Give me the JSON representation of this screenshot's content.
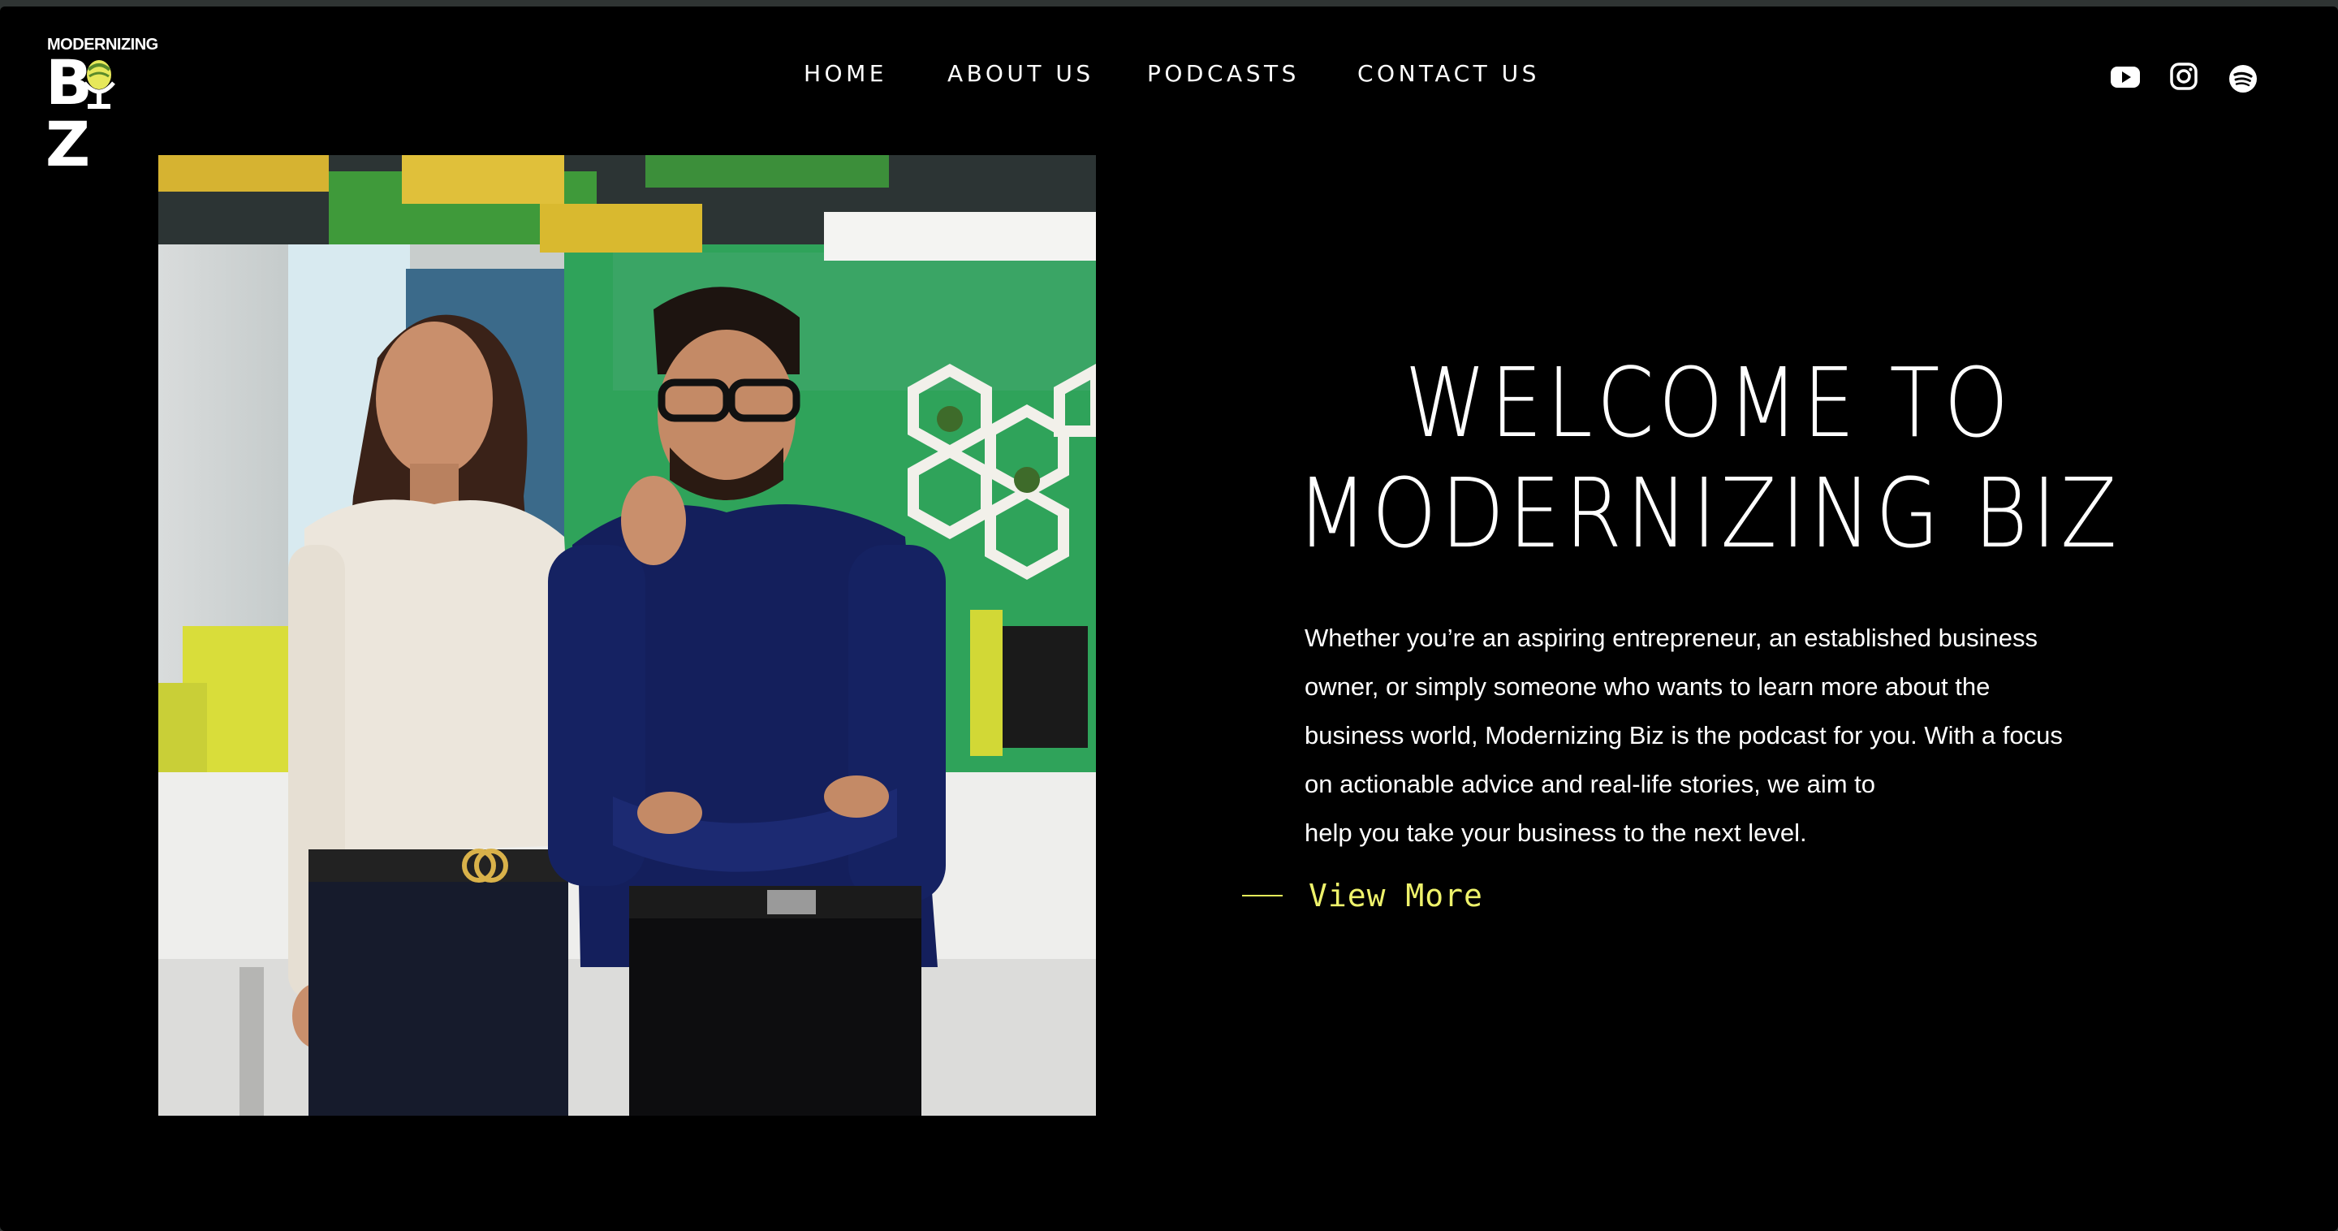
{
  "brand": {
    "top_text": "MODERNIZING",
    "word": "BIZ"
  },
  "nav": {
    "items": [
      {
        "label": "HOME"
      },
      {
        "label": "ABOUT US"
      },
      {
        "label": "PODCASTS"
      },
      {
        "label": "CONTACT US"
      }
    ]
  },
  "social": [
    {
      "icon": "youtube-icon"
    },
    {
      "icon": "instagram-icon"
    },
    {
      "icon": "spotify-icon"
    }
  ],
  "hero": {
    "title_line_1": "WELCOME TO",
    "title_line_2": "MODERNIZING BIZ",
    "description_lines": [
      "Whether you’re an aspiring entrepreneur, an established business",
      "owner, or simply someone who wants to learn more about the",
      "business world, Modernizing Biz is the podcast for you. With a focus",
      "on actionable advice and real-life stories, we aim to",
      "help you take your business to the next level."
    ],
    "cta_label": "View More"
  },
  "colors": {
    "background": "#000000",
    "accent": "#eef26b",
    "text": "#ffffff"
  }
}
